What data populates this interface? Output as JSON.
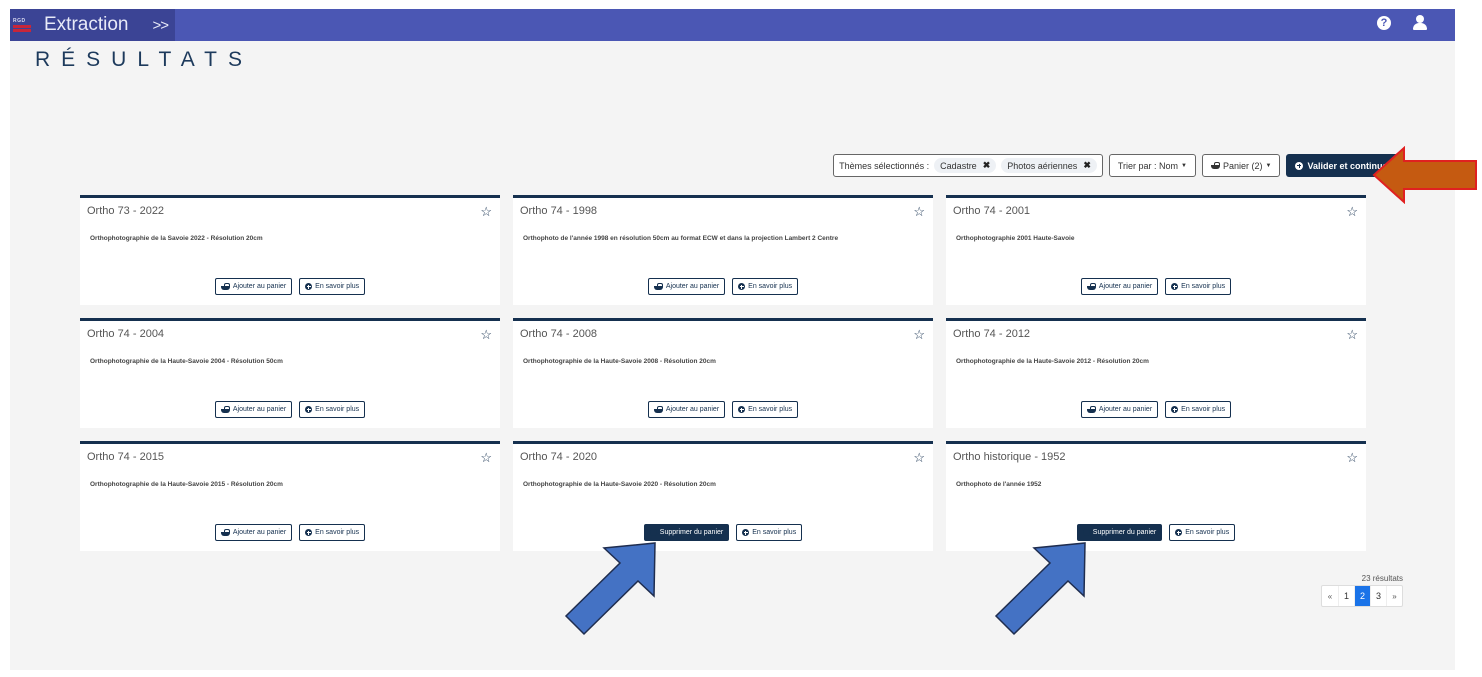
{
  "header": {
    "logo_text": "RGD",
    "app_title": "Extraction",
    "collapse_label": ">>",
    "icons": [
      "help-icon",
      "user-icon"
    ]
  },
  "page": {
    "title": "RÉSULTATS"
  },
  "toolbar": {
    "themes_label": "Thèmes sélectionnés :",
    "themes": [
      {
        "label": "Cadastre",
        "remove_icon": "close-icon"
      },
      {
        "label": "Photos aériennes",
        "remove_icon": "close-icon"
      }
    ],
    "sort_label": "Trier par : Nom",
    "basket_label": "Panier (2)",
    "validate_label": "Valider et continuer"
  },
  "cards": [
    {
      "title": "Ortho 73 - 2022",
      "description": "Orthophotographie de la Savoie 2022 - Résolution 20cm",
      "in_basket": false,
      "basket_label": "Ajouter au panier",
      "more_label": "En savoir plus"
    },
    {
      "title": "Ortho 74 - 1998",
      "description": "Orthophoto de l'année 1998 en résolution 50cm au format ECW et dans la projection Lambert 2 Centre",
      "in_basket": false,
      "basket_label": "Ajouter au panier",
      "more_label": "En savoir plus"
    },
    {
      "title": "Ortho 74 - 2001",
      "description": "Orthophotographie 2001 Haute-Savoie",
      "in_basket": false,
      "basket_label": "Ajouter au panier",
      "more_label": "En savoir plus"
    },
    {
      "title": "Ortho 74 - 2004",
      "description": "Orthophotographie de la Haute-Savoie 2004 - Résolution 50cm",
      "in_basket": false,
      "basket_label": "Ajouter au panier",
      "more_label": "En savoir plus"
    },
    {
      "title": "Ortho 74 - 2008",
      "description": "Orthophotographie de la Haute-Savoie 2008 - Résolution 20cm",
      "in_basket": false,
      "basket_label": "Ajouter au panier",
      "more_label": "En savoir plus"
    },
    {
      "title": "Ortho 74 - 2012",
      "description": "Orthophotographie de la Haute-Savoie 2012 - Résolution 20cm",
      "in_basket": false,
      "basket_label": "Ajouter au panier",
      "more_label": "En savoir plus"
    },
    {
      "title": "Ortho 74 - 2015",
      "description": "Orthophotographie de la Haute-Savoie 2015 - Résolution 20cm",
      "in_basket": false,
      "basket_label": "Ajouter au panier",
      "more_label": "En savoir plus"
    },
    {
      "title": "Ortho 74 - 2020",
      "description": "Orthophotographie de la Haute-Savoie 2020 - Résolution 20cm",
      "in_basket": true,
      "basket_label": "Supprimer du panier",
      "more_label": "En savoir plus"
    },
    {
      "title": "Ortho historique - 1952",
      "description": "Orthophoto de l'année 1952",
      "in_basket": true,
      "basket_label": "Supprimer du panier",
      "more_label": "En savoir plus"
    }
  ],
  "pagination": {
    "results_label": "23 résultats",
    "prev_label": "«",
    "next_label": "»",
    "pages": [
      "1",
      "2",
      "3"
    ],
    "current_page": "2"
  },
  "annotations": {
    "colors": {
      "orange_arrow": "#c55a11",
      "orange_border": "#e02020",
      "blue_arrow": "#4472c4",
      "blue_border": "#1f2d4f"
    }
  },
  "colors": {
    "header_bg": "#4b57b4",
    "brand_bg": "#3b4495",
    "primary": "#15304f",
    "page_active": "#1a73e8"
  }
}
